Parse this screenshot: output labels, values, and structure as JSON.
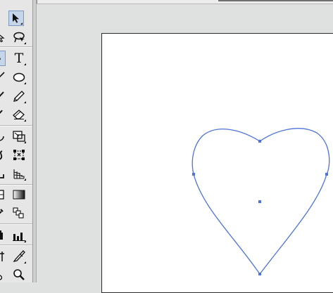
{
  "window": {
    "title": ""
  },
  "toolbox": {
    "tools": [
      {
        "id": "selection",
        "icon": "selection-arrow-icon",
        "selected": true
      },
      {
        "id": "direct-select-edge",
        "icon": "direct-selection-icon"
      },
      {
        "id": "lasso",
        "icon": "lasso-icon"
      },
      {
        "id": "pen-edge",
        "icon": "pen-icon"
      },
      {
        "id": "type",
        "icon": "type-icon",
        "label": "T"
      },
      {
        "id": "line-edge",
        "icon": "line-segment-icon"
      },
      {
        "id": "ellipse",
        "icon": "ellipse-icon"
      },
      {
        "id": "paintbrush-edge",
        "icon": "paintbrush-icon"
      },
      {
        "id": "pencil",
        "icon": "pencil-icon"
      },
      {
        "id": "blob-edge",
        "icon": "blob-brush-icon"
      },
      {
        "id": "eraser",
        "icon": "eraser-icon"
      },
      {
        "id": "rotate-edge",
        "icon": "rotate-icon"
      },
      {
        "id": "scale",
        "icon": "scale-icon"
      },
      {
        "id": "warp-edge",
        "icon": "warp-icon"
      },
      {
        "id": "free-transform",
        "icon": "free-transform-icon"
      },
      {
        "id": "shape-builder-edge",
        "icon": "shape-builder-icon"
      },
      {
        "id": "perspective-grid",
        "icon": "perspective-grid-icon"
      },
      {
        "id": "mesh-edge",
        "icon": "mesh-icon"
      },
      {
        "id": "gradient",
        "icon": "gradient-icon"
      },
      {
        "id": "eyedropper-edge",
        "icon": "eyedropper-icon"
      },
      {
        "id": "blend",
        "icon": "blend-icon"
      },
      {
        "id": "symbol-sprayer-edge",
        "icon": "symbol-sprayer-icon"
      },
      {
        "id": "column-graph",
        "icon": "column-graph-icon"
      },
      {
        "id": "artboard-edge",
        "icon": "artboard-icon"
      },
      {
        "id": "slice",
        "icon": "slice-icon"
      },
      {
        "id": "hand-edge",
        "icon": "hand-icon"
      },
      {
        "id": "zoom",
        "icon": "zoom-icon"
      }
    ]
  },
  "canvas": {
    "artboard_color": "#ffffff",
    "path_color": "#4f74d8",
    "shape": "heart",
    "selected": true
  }
}
